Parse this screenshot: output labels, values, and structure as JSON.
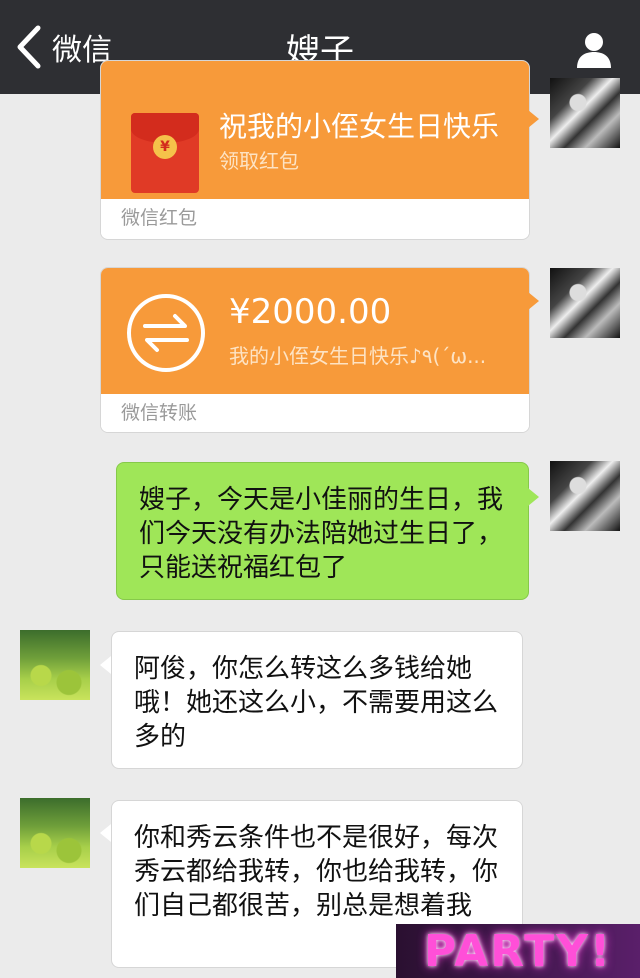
{
  "header": {
    "back_label": "微信",
    "title": "嫂子"
  },
  "messages": {
    "red_packet": {
      "greeting": "祝我的小侄女生日快乐",
      "action": "领取红包",
      "footer": "微信红包"
    },
    "transfer": {
      "amount": "¥2000.00",
      "note": "我的小侄女生日快乐♪٩(´ω...",
      "footer": "微信转账"
    },
    "sent_text": "嫂子，今天是小佳丽的生日，我们今天没有办法陪她过生日了，只能送祝福红包了",
    "reply_1": "阿俊，你怎么转这么多钱给她哦！她还这么小，不需要用这么多的",
    "reply_2": "你和秀云条件也不是很好，每次秀云都给我转，你也给我转，你们自己都很苦，别总是想着我"
  },
  "watermark": "PARTY!",
  "colors": {
    "header_bg": "#2e2f33",
    "chat_bg": "#ebebeb",
    "card_orange": "#f79a3a",
    "bubble_green": "#9fe658",
    "bubble_white": "#ffffff"
  },
  "icons": [
    "chevron-left-icon",
    "profile-icon",
    "red-packet-icon",
    "transfer-arrows-icon"
  ]
}
